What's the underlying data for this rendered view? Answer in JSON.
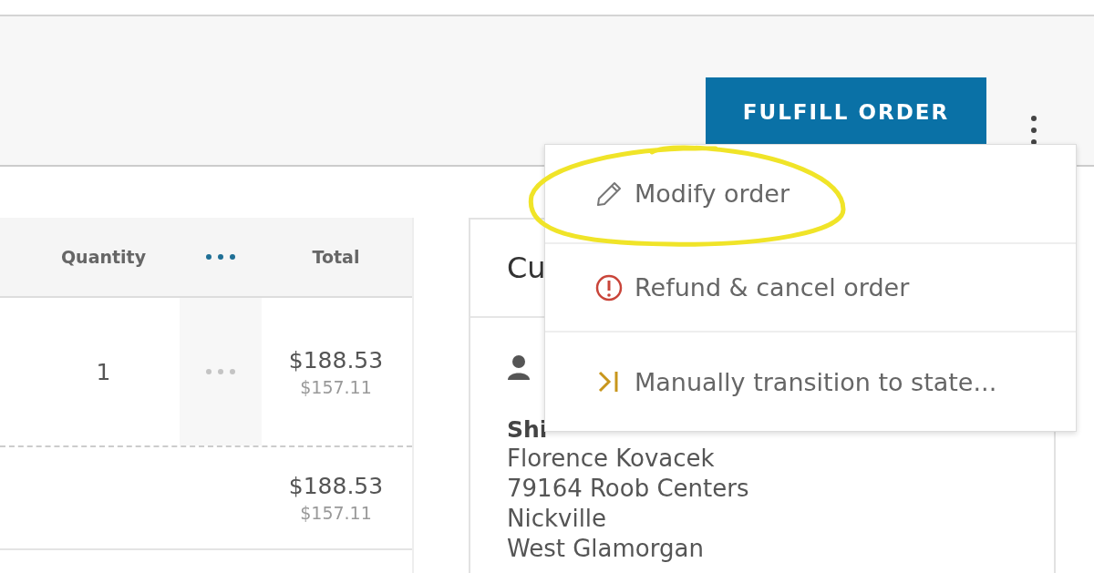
{
  "header": {
    "primary_button": "FULFILL ORDER"
  },
  "table": {
    "columns": [
      {
        "kind": "text",
        "label": "Quantity"
      },
      {
        "kind": "menu"
      },
      {
        "kind": "text",
        "label": "Total"
      }
    ],
    "rows": [
      {
        "kind": "line",
        "quantity": "1",
        "total": "$188.53",
        "total_net": "$157.11"
      },
      {
        "kind": "subtotal",
        "total": "$188.53",
        "total_net": "$157.11"
      }
    ]
  },
  "customer_card": {
    "title": "Cu",
    "shipping_heading": "Shi",
    "address_lines": [
      "Florence Kovacek",
      "79164 Roob Centers",
      "Nickville",
      "West Glamorgan"
    ]
  },
  "menu": {
    "items": [
      {
        "kind": "edit",
        "label": "Modify order",
        "highlighted": true
      },
      {
        "kind": "alert",
        "label": "Refund & cancel order",
        "highlighted": false
      },
      {
        "kind": "transition",
        "label": "Manually transition to state...",
        "highlighted": false
      }
    ]
  }
}
